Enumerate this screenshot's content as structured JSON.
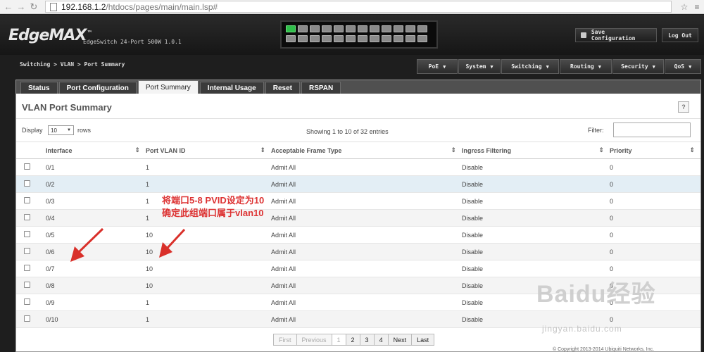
{
  "browser": {
    "url_host": "192.168.1.2",
    "url_path": "/htdocs/pages/main/main.lsp#"
  },
  "header": {
    "logo": "EdgeMAX",
    "logo_tm": "™",
    "device_name": "EdgeSwitch 24-Port 500W 1.0.1",
    "save_button": "Save Configuration",
    "logout_button": "Log Out",
    "ports_up": [
      1
    ]
  },
  "breadcrumb": "Switching > VLAN > Port Summary",
  "menu": {
    "items": [
      "PoE",
      "System",
      "Switching",
      "Routing",
      "Security",
      "QoS"
    ]
  },
  "tabs": [
    "Status",
    "Port Configuration",
    "Port Summary",
    "Internal Usage",
    "Reset",
    "RSPAN"
  ],
  "page": {
    "title": "VLAN Port Summary",
    "help": "?",
    "display_label": "Display",
    "display_value": "10",
    "rows_label": "rows",
    "showing": "Showing 1 to 10 of 32 entries",
    "filter_label": "Filter:",
    "filter_value": ""
  },
  "table": {
    "headers": [
      "Interface",
      "Port VLAN ID",
      "Acceptable Frame Type",
      "Ingress Filtering",
      "Priority"
    ],
    "rows": [
      [
        "0/1",
        "1",
        "Admit All",
        "Disable",
        "0"
      ],
      [
        "0/2",
        "1",
        "Admit All",
        "Disable",
        "0"
      ],
      [
        "0/3",
        "1",
        "Admit All",
        "Disable",
        "0"
      ],
      [
        "0/4",
        "1",
        "Admit All",
        "Disable",
        "0"
      ],
      [
        "0/5",
        "10",
        "Admit All",
        "Disable",
        "0"
      ],
      [
        "0/6",
        "10",
        "Admit All",
        "Disable",
        "0"
      ],
      [
        "0/7",
        "10",
        "Admit All",
        "Disable",
        "0"
      ],
      [
        "0/8",
        "10",
        "Admit All",
        "Disable",
        "0"
      ],
      [
        "0/9",
        "1",
        "Admit All",
        "Disable",
        "0"
      ],
      [
        "0/10",
        "1",
        "Admit All",
        "Disable",
        "0"
      ]
    ]
  },
  "pager": [
    "First",
    "Previous",
    "1",
    "2",
    "3",
    "4",
    "Next",
    "Last"
  ],
  "annotation": {
    "line1": "将端口5-8 PVID设定为10",
    "line2": "确定此组端口属于vlan10"
  },
  "watermark": {
    "text": "Baidu经验",
    "url": "jingyan.baidu.com"
  },
  "footer": "© Copyright 2013-2014 Ubiquiti Networks, Inc."
}
